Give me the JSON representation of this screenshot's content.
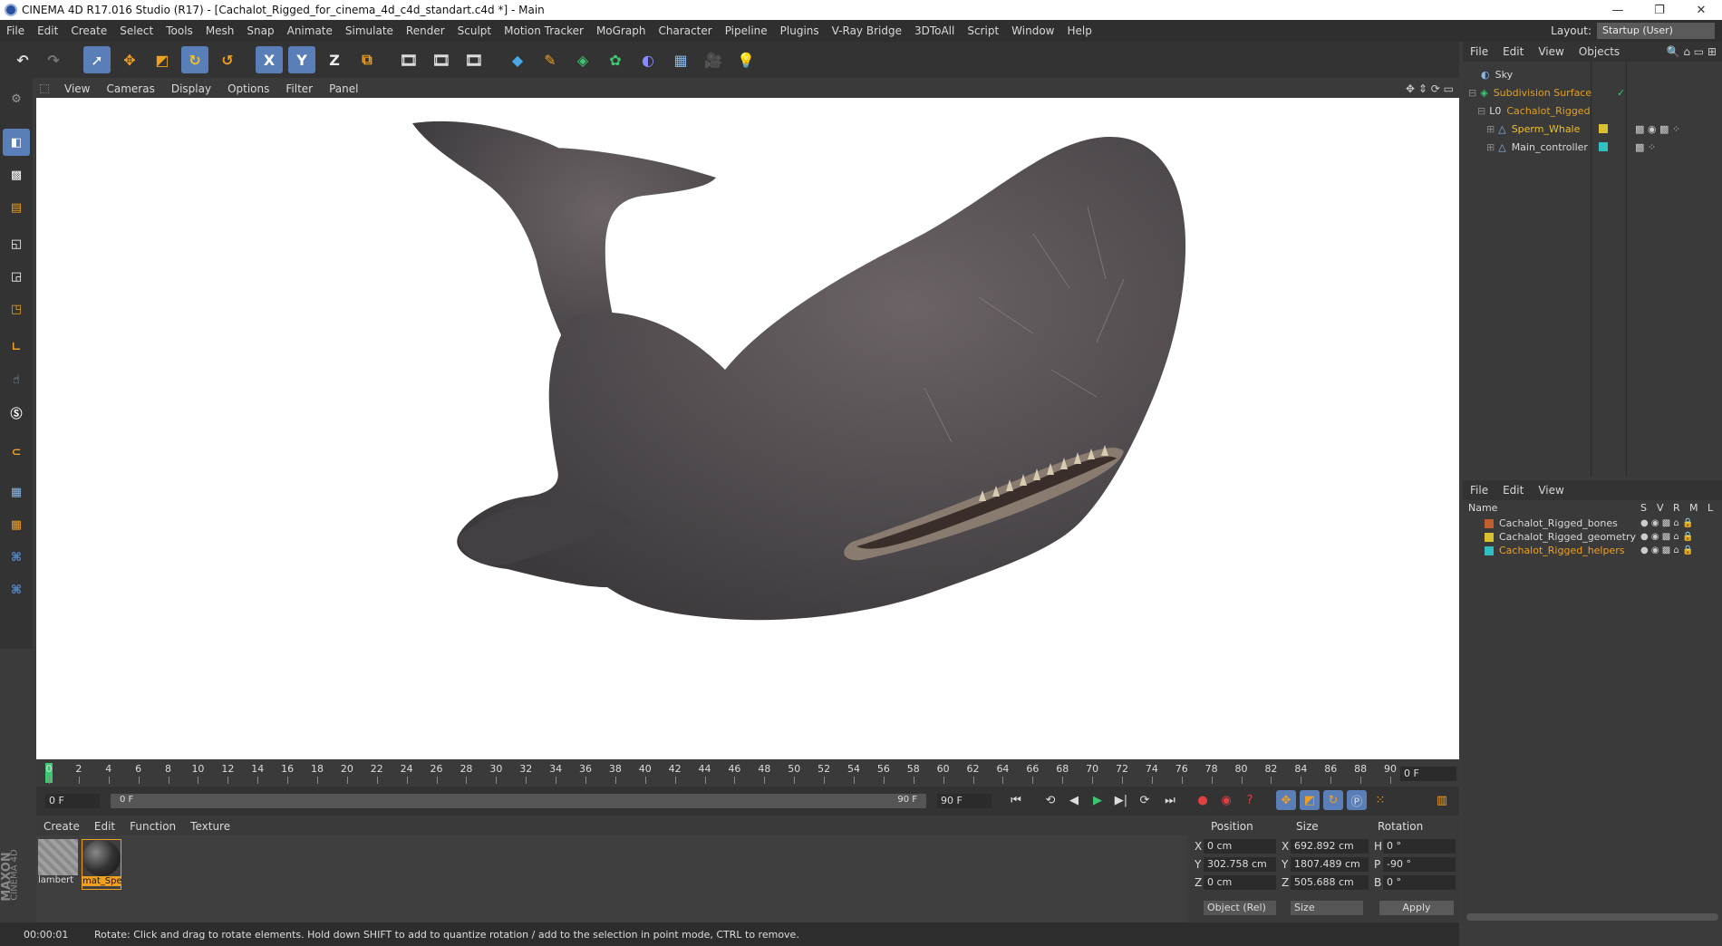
{
  "titlebar": {
    "title": "CINEMA 4D R17.016 Studio (R17) - [Cachalot_Rigged_for_cinema_4d_c4d_standart.c4d *] - Main",
    "minimize": "—",
    "restore": "❐",
    "close": "✕"
  },
  "menubar": {
    "items": [
      "File",
      "Edit",
      "Create",
      "Select",
      "Tools",
      "Mesh",
      "Snap",
      "Animate",
      "Simulate",
      "Render",
      "Sculpt",
      "Motion Tracker",
      "MoGraph",
      "Character",
      "Pipeline",
      "Plugins",
      "V-Ray Bridge",
      "3DToAll",
      "Script",
      "Window",
      "Help"
    ],
    "layout_label": "Layout:",
    "layout_value": "Startup (User)"
  },
  "toolbar": {
    "axis_x": "X",
    "axis_y": "Y",
    "axis_z": "Z"
  },
  "viewport": {
    "menu": [
      "View",
      "Cameras",
      "Display",
      "Options",
      "Filter",
      "Panel"
    ]
  },
  "timeline": {
    "ticks": [
      "0",
      "2",
      "4",
      "6",
      "8",
      "10",
      "12",
      "14",
      "16",
      "18",
      "20",
      "22",
      "24",
      "26",
      "28",
      "30",
      "32",
      "34",
      "36",
      "38",
      "40",
      "42",
      "44",
      "46",
      "48",
      "50",
      "52",
      "54",
      "56",
      "58",
      "60",
      "62",
      "64",
      "66",
      "68",
      "70",
      "72",
      "74",
      "76",
      "78",
      "80",
      "82",
      "84",
      "86",
      "88",
      "90"
    ],
    "current_frame": "0 F"
  },
  "transport": {
    "start_field": "0 F",
    "range_start": "0 F",
    "range_end": "90 F",
    "end_field": "90 F"
  },
  "materials": {
    "menu": [
      "Create",
      "Edit",
      "Function",
      "Texture"
    ],
    "items": [
      {
        "label": "lambert"
      },
      {
        "label": "mat_Spe"
      }
    ]
  },
  "coords": {
    "headers": {
      "position": "Position",
      "size": "Size",
      "rotation": "Rotation"
    },
    "rows": [
      {
        "axis": "X",
        "pos": "0 cm",
        "size_axis": "X",
        "size": "692.892 cm",
        "rot_axis": "H",
        "rot": "0 °"
      },
      {
        "axis": "Y",
        "pos": "302.758 cm",
        "size_axis": "Y",
        "size": "1807.489 cm",
        "rot_axis": "P",
        "rot": "-90 °"
      },
      {
        "axis": "Z",
        "pos": "0 cm",
        "size_axis": "Z",
        "size": "505.688 cm",
        "rot_axis": "B",
        "rot": "0 °"
      }
    ],
    "mode": "Object (Rel)",
    "size_mode": "Size",
    "apply": "Apply"
  },
  "status": {
    "time": "00:00:01",
    "message": "Rotate: Click and drag to rotate elements. Hold down SHIFT to add to quantize rotation / add to the selection in point mode, CTRL to remove."
  },
  "objects_panel": {
    "menu": [
      "File",
      "Edit",
      "View",
      "Objects"
    ],
    "items": [
      {
        "label": "Sky",
        "color": "#d8d8d8"
      },
      {
        "label": "Subdivision Surface",
        "color": "#e0a020"
      },
      {
        "label": "Cachalot_Rigged",
        "color": "#e0a020"
      },
      {
        "label": "Sperm_Whale",
        "color": "#f0c020"
      },
      {
        "label": "Main_controller",
        "color": "#d8d8d8"
      }
    ]
  },
  "layers_panel": {
    "menu": [
      "File",
      "Edit",
      "View"
    ],
    "headers": {
      "name": "Name",
      "s": "S",
      "v": "V",
      "r": "R",
      "m": "M",
      "l": "L"
    },
    "items": [
      {
        "label": "Cachalot_Rigged_bones",
        "swatch": "#c06030",
        "color": "#d8d8d8"
      },
      {
        "label": "Cachalot_Rigged_geometry",
        "swatch": "#d8c030",
        "color": "#d8d8d8"
      },
      {
        "label": "Cachalot_Rigged_helpers",
        "swatch": "#30c0c0",
        "color": "#f0a020"
      }
    ]
  },
  "brand": {
    "line1": "MAXON",
    "line2": "CINEMA 4D"
  },
  "colors": {
    "accent": "#f0a020",
    "active_tool": "#5a7fb8"
  }
}
